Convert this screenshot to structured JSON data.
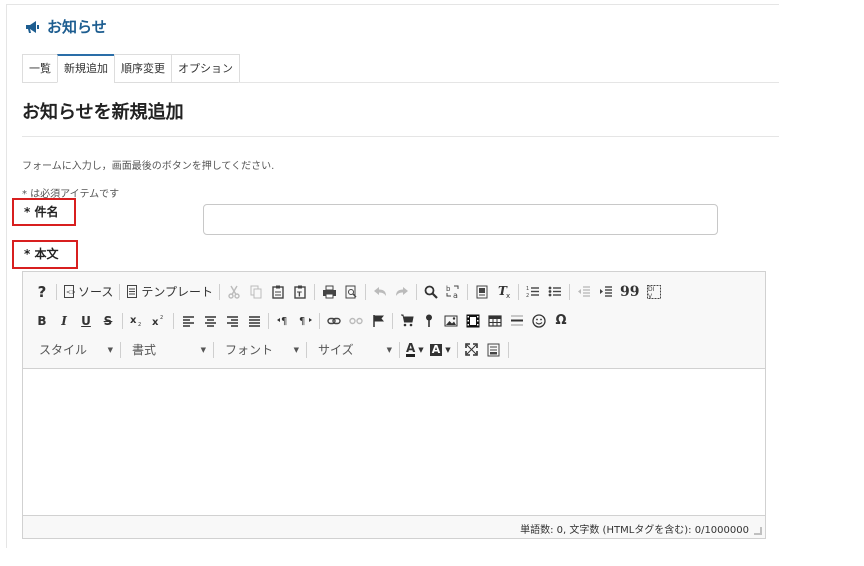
{
  "module": {
    "title": "お知らせ",
    "icon": "megaphone-icon"
  },
  "tabs": [
    {
      "label": "一覧",
      "active": false
    },
    {
      "label": "新規追加",
      "active": true
    },
    {
      "label": "順序変更",
      "active": false
    },
    {
      "label": "オプション",
      "active": false
    }
  ],
  "page": {
    "heading": "お知らせを新規追加",
    "instructions": "フォームに入力し，画面最後のボタンを押してください.",
    "required_note": "* は必須アイテムです"
  },
  "fields": {
    "subject": {
      "label": "* 件名",
      "value": ""
    },
    "body": {
      "label": "* 本文"
    }
  },
  "editor": {
    "toolbar": {
      "help": "?",
      "source_label": "ソース",
      "template_label": "テンプレート",
      "bold": "B",
      "italic": "I",
      "underline": "U",
      "strike": "S",
      "quote": "99",
      "special_char": "Ω",
      "style_combo": "スタイル",
      "format_combo": "書式",
      "font_combo": "フォント",
      "size_combo": "サイズ",
      "text_color": "A",
      "bg_color": "A"
    },
    "status": "単語数: 0, 文字数 (HTMLタグを含む): 0/1000000"
  },
  "colors": {
    "accent": "#1d5d90",
    "highlight": "#d81f1f"
  }
}
